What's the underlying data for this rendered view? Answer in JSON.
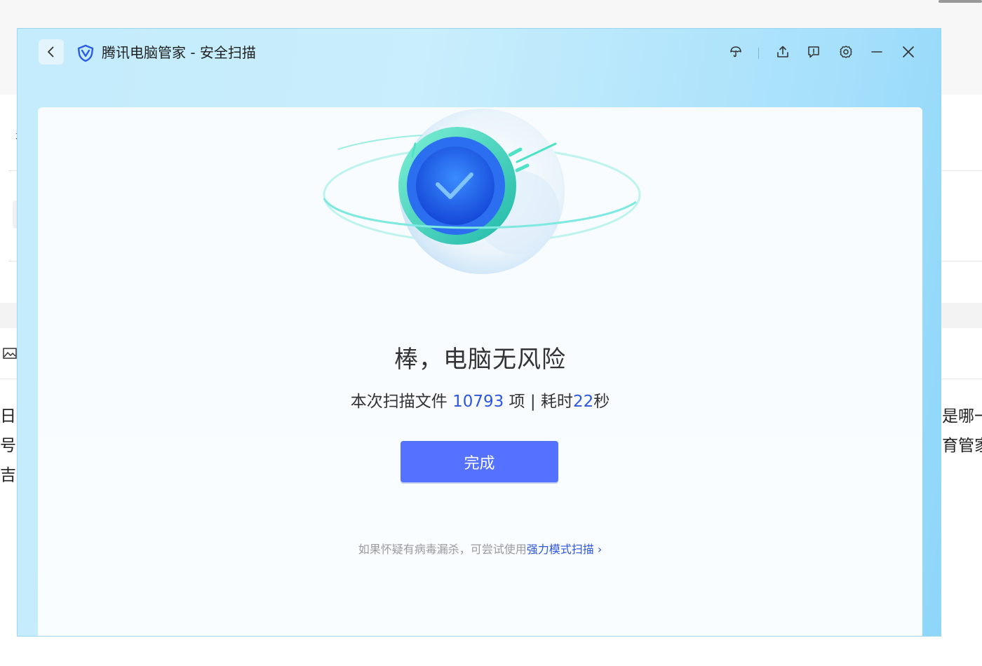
{
  "background": {
    "left_fragments": [
      "彳",
      "日，",
      "号开",
      "吉男"
    ],
    "right_fragments": [
      "是哪一",
      "育管家"
    ]
  },
  "window": {
    "title": "腾讯电脑管家 - 安全扫描",
    "icons": [
      "back-icon",
      "shield-logo-icon",
      "umbrella-icon",
      "share-icon",
      "feedback-icon",
      "gear-icon",
      "minimize-icon",
      "close-icon"
    ]
  },
  "result": {
    "heading": "棒，电脑无风险",
    "stats_prefix": "本次扫描文件 ",
    "file_count": "10793",
    "stats_mid": " 项 | 耗时",
    "seconds": "22",
    "stats_suffix": "秒"
  },
  "done_button": "完成",
  "hint": {
    "text": "如果怀疑有病毒漏杀，可尝试使用",
    "link": "强力模式扫描",
    "chevron": "›"
  },
  "colors": {
    "accent": "#5472ff",
    "link": "#2f56e0",
    "title_bg": "#c4ecfc"
  }
}
